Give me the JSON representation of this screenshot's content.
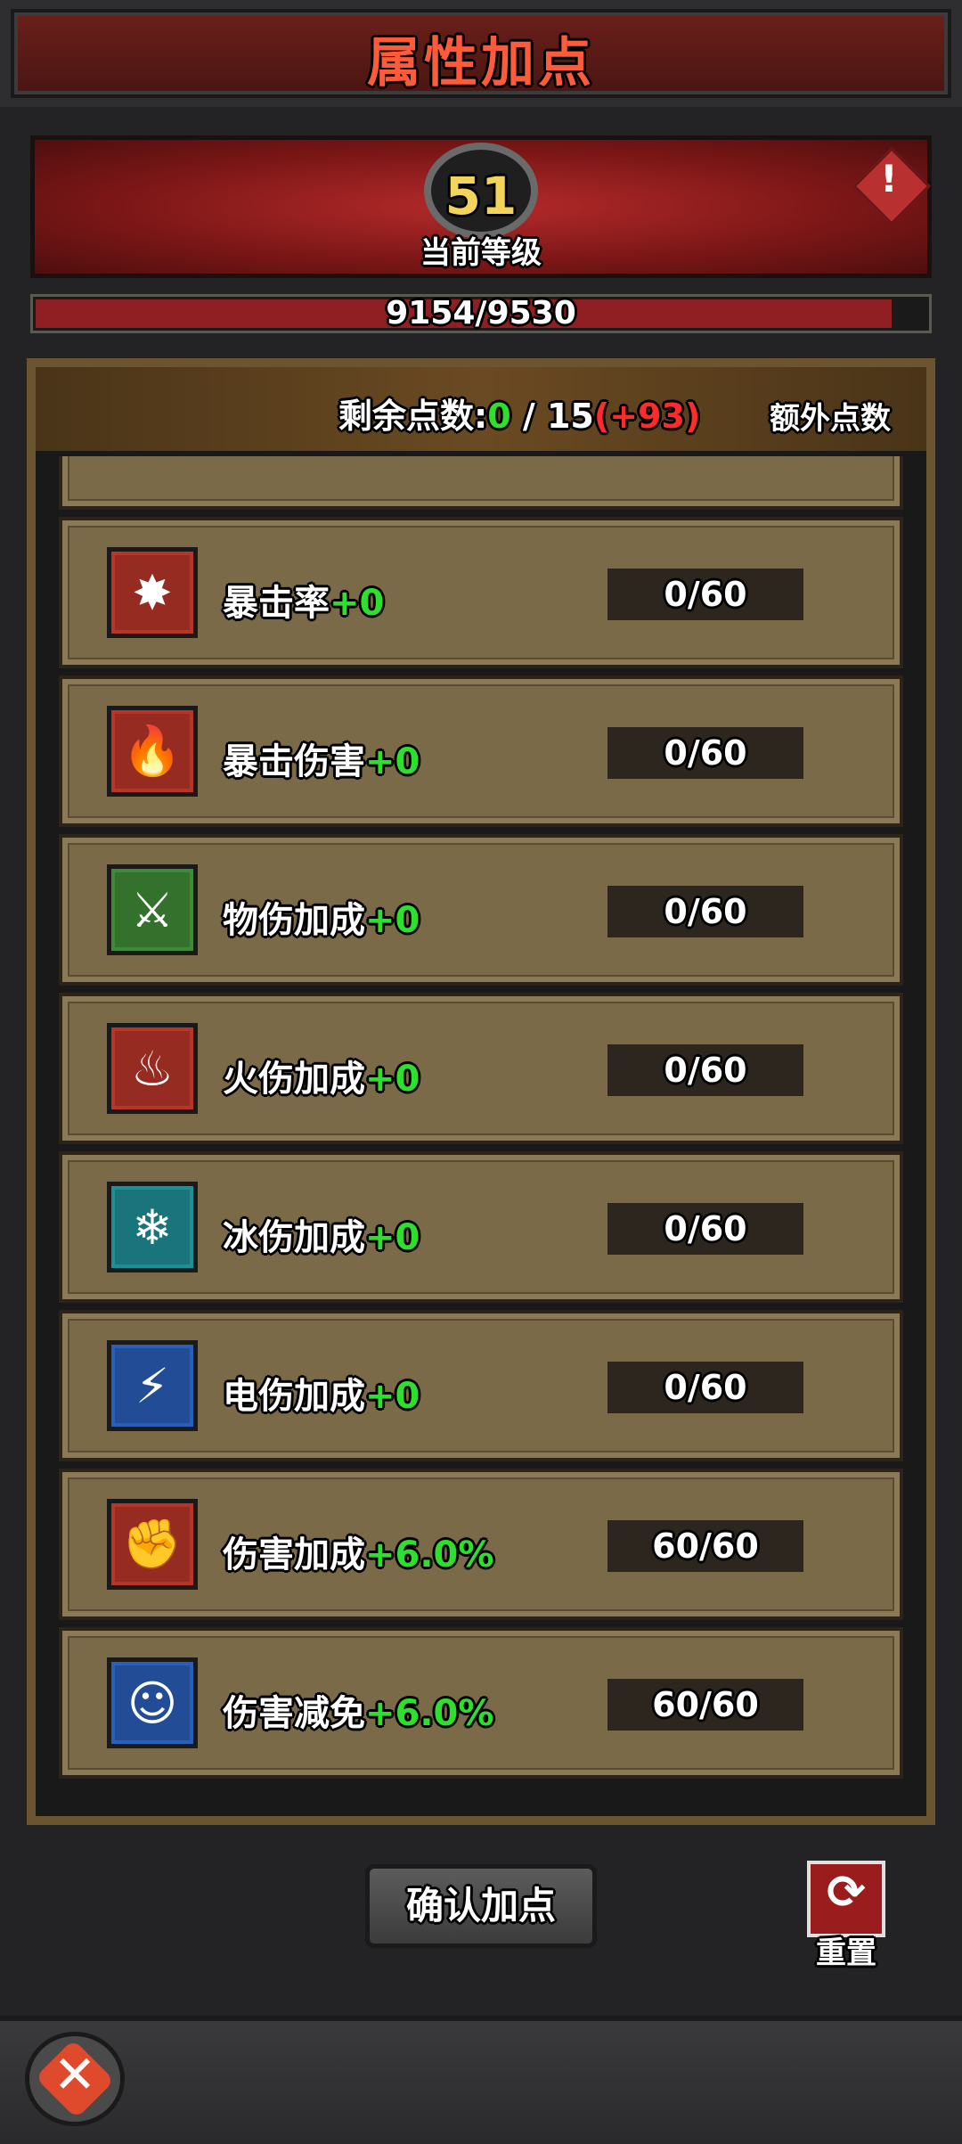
{
  "header": {
    "title": "属性加点"
  },
  "level": {
    "value": "51",
    "label": "当前等级"
  },
  "experience": {
    "text": "9154/9530",
    "current": 9154,
    "max": 9530
  },
  "points": {
    "label_prefix": "剩余点数:",
    "available": "0",
    "separator": " / 15",
    "extra": "(+93)",
    "extra_button": "额外点数"
  },
  "attributes": [
    {
      "name": "暴击率",
      "bonus": "+0",
      "count": "0/60",
      "icon": "crit-rate-icon",
      "color": "#b8352a",
      "glyph": "✸"
    },
    {
      "name": "暴击伤害",
      "bonus": "+0",
      "count": "0/60",
      "icon": "crit-damage-icon",
      "color": "#b8352a",
      "glyph": "🔥"
    },
    {
      "name": "物伤加成",
      "bonus": "+0",
      "count": "0/60",
      "icon": "physical-damage-icon",
      "color": "#3f8a38",
      "glyph": "⚔"
    },
    {
      "name": "火伤加成",
      "bonus": "+0",
      "count": "0/60",
      "icon": "fire-damage-icon",
      "color": "#b8352a",
      "glyph": "♨"
    },
    {
      "name": "冰伤加成",
      "bonus": "+0",
      "count": "0/60",
      "icon": "ice-damage-icon",
      "color": "#1f8f96",
      "glyph": "❄"
    },
    {
      "name": "电伤加成",
      "bonus": "+0",
      "count": "0/60",
      "icon": "lightning-damage-icon",
      "color": "#2a5fb8",
      "glyph": "⚡"
    },
    {
      "name": "伤害加成",
      "bonus": "+6.0%",
      "count": "60/60",
      "icon": "damage-boost-icon",
      "color": "#b8352a",
      "glyph": "✊"
    },
    {
      "name": "伤害减免",
      "bonus": "+6.0%",
      "count": "60/60",
      "icon": "damage-reduction-icon",
      "color": "#2a5fb8",
      "glyph": "☺"
    }
  ],
  "buttons": {
    "confirm": "确认加点",
    "reset": "重置"
  }
}
